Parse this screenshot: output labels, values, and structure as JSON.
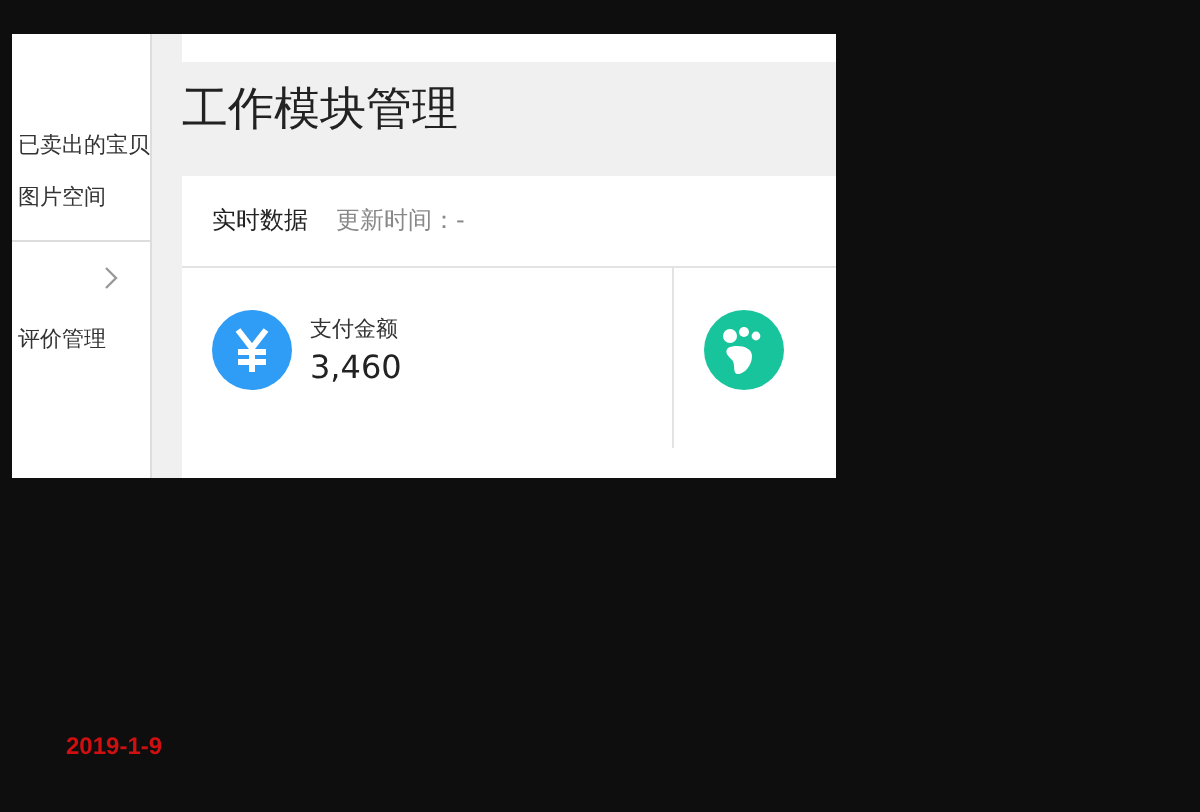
{
  "sidebar": {
    "items": [
      {
        "label": "已卖出的宝贝",
        "kind": "link"
      },
      {
        "label": "图片空间",
        "kind": "link"
      },
      {
        "kind": "divider"
      },
      {
        "kind": "group"
      },
      {
        "label": "评价管理",
        "kind": "link"
      }
    ]
  },
  "page": {
    "title": "工作模块管理"
  },
  "card": {
    "title": "实时数据",
    "update": "更新时间：-",
    "stats": [
      {
        "kind": "money",
        "label": "支付金额",
        "value": "3,460"
      },
      {
        "kind": "visitors"
      }
    ]
  },
  "date": "2019-1-9"
}
